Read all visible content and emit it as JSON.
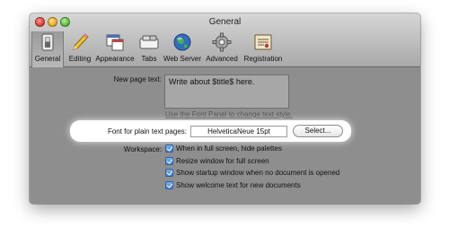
{
  "window": {
    "title": "General"
  },
  "toolbar": {
    "items": [
      {
        "label": "General",
        "icon": "general-switch-icon",
        "selected": true
      },
      {
        "label": "Editing",
        "icon": "pencil-icon",
        "selected": false
      },
      {
        "label": "Appearance",
        "icon": "appearance-icon",
        "selected": false
      },
      {
        "label": "Tabs",
        "icon": "tabs-icon",
        "selected": false
      },
      {
        "label": "Web Server",
        "icon": "globe-icon",
        "selected": false
      },
      {
        "label": "Advanced",
        "icon": "gear-icon",
        "selected": false
      },
      {
        "label": "Registration",
        "icon": "registration-icon",
        "selected": false
      }
    ]
  },
  "content": {
    "new_page_label": "New page text:",
    "new_page_value": "Write about $title$ here.",
    "font_panel_link": "Use the Font Panel to change text style.",
    "font_label": "Font for plain text pages:",
    "font_value": "HelveticaNeue 15pt",
    "select_button": "Select...",
    "workspace_label": "Workspace:",
    "checkboxes": [
      {
        "label": "When in full screen, hide palettes",
        "checked": true
      },
      {
        "label": "Resize window for full screen",
        "checked": true
      },
      {
        "label": "Show startup window when no document is opened",
        "checked": true
      },
      {
        "label": "Show welcome text for new documents",
        "checked": true
      }
    ]
  },
  "colors": {
    "accent": "#3f7fcf",
    "panel_background": "#8e8e8e",
    "highlight": "#ffffff"
  }
}
